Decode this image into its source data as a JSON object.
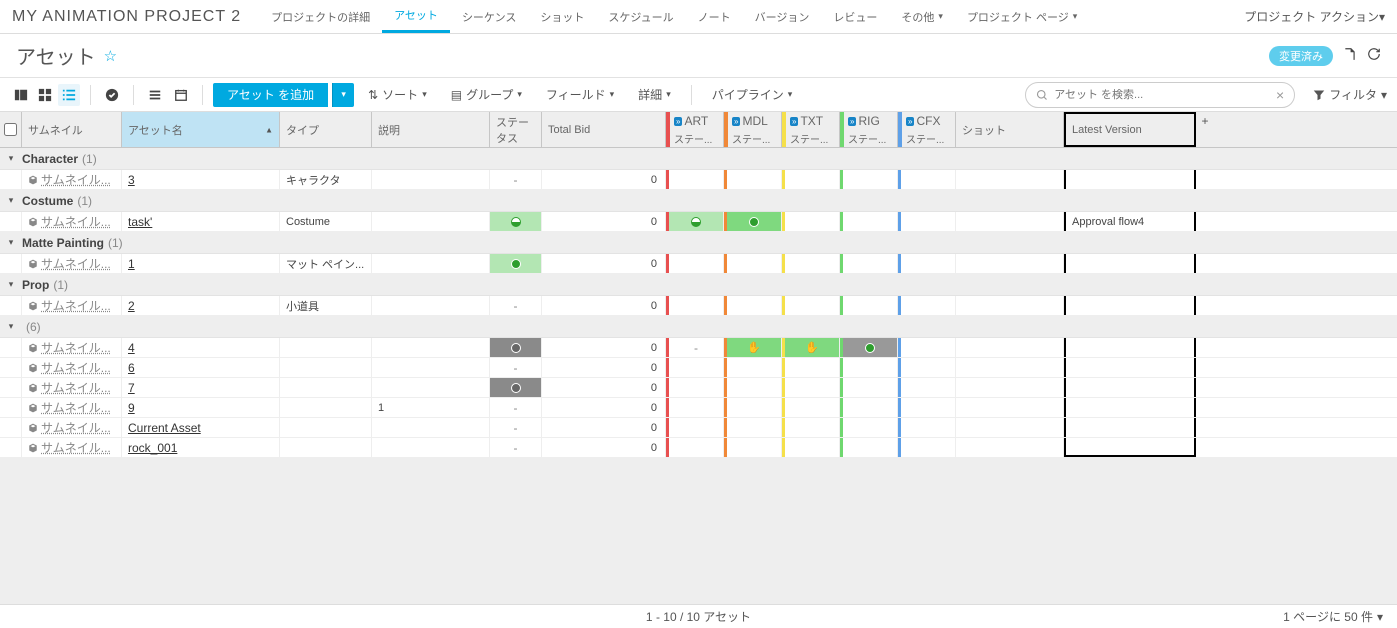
{
  "topbar": {
    "project": "MY ANIMATION PROJECT 2",
    "tabs": [
      "プロジェクトの詳細",
      "アセット",
      "シーケンス",
      "ショット",
      "スケジュール",
      "ノート",
      "バージョン",
      "レビュー",
      "その他",
      "プロジェクト ページ"
    ],
    "active_tab": 1,
    "dropdown_tabs": [
      8,
      9
    ],
    "actions": "プロジェクト アクション"
  },
  "page": {
    "title": "アセット",
    "badge": "変更済み"
  },
  "toolbar": {
    "add": "アセット を追加",
    "sort": "ソート",
    "group": "グループ",
    "fields": "フィールド",
    "detail": "詳細",
    "pipeline": "パイプライン",
    "search_placeholder": "アセット を検索...",
    "filter": "フィルタ"
  },
  "columns": {
    "thumb": "サムネイル",
    "name": "アセット名",
    "type": "タイプ",
    "desc": "説明",
    "status": "ステータス",
    "bid": "Total Bid",
    "shot": "ショット",
    "latest": "Latest Version",
    "pipe_sub": "ステー...",
    "pipes": [
      {
        "code": "ART",
        "color": "#e85050"
      },
      {
        "code": "MDL",
        "color": "#f08838"
      },
      {
        "code": "TXT",
        "color": "#f5e04a"
      },
      {
        "code": "RIG",
        "color": "#6fd86f"
      },
      {
        "code": "CFX",
        "color": "#5ea0e8"
      }
    ]
  },
  "groups": [
    {
      "name": "Character",
      "count": 1,
      "rows": [
        {
          "name": "3",
          "type": "キャラクタ",
          "status": "dash",
          "bid": "0",
          "pipes": [
            "",
            "",
            "",
            "",
            ""
          ],
          "latest": ""
        }
      ]
    },
    {
      "name": "Costume",
      "count": 1,
      "rows": [
        {
          "name": "task'",
          "type": "Costume",
          "status": "half-green-light",
          "bid": "0",
          "pipes": [
            "half-green-light",
            "dot-green",
            null,
            null,
            null
          ],
          "latest": "Approval flow4"
        }
      ]
    },
    {
      "name": "Matte Painting",
      "count": 1,
      "rows": [
        {
          "name": "1",
          "type": "マット ペイン...",
          "status": "dot-green-light",
          "bid": "0",
          "pipes": [
            "",
            "",
            "",
            "",
            ""
          ],
          "latest": ""
        }
      ]
    },
    {
      "name": "Prop",
      "count": 1,
      "rows": [
        {
          "name": "2",
          "type": "小道具",
          "status": "dash",
          "bid": "0",
          "pipes": [
            "",
            "",
            "",
            "",
            ""
          ],
          "latest": ""
        }
      ]
    },
    {
      "name": "",
      "count": 6,
      "rows": [
        {
          "name": "4",
          "type": "",
          "status": "grey-dot",
          "bid": "0",
          "pipes": [
            "dash",
            "hand-green",
            "hand-green",
            "dot-grey-bg",
            ""
          ],
          "latest": ""
        },
        {
          "name": "6",
          "type": "",
          "status": "dash",
          "bid": "0",
          "pipes": [
            "",
            "",
            "",
            "",
            ""
          ],
          "latest": ""
        },
        {
          "name": "7",
          "type": "",
          "status": "grey-dot",
          "bid": "0",
          "pipes": [
            "",
            "",
            "",
            "",
            ""
          ],
          "latest": ""
        },
        {
          "name": "9",
          "type": "",
          "desc": "1",
          "status": "dash",
          "bid": "0",
          "pipes": [
            "",
            "",
            "",
            "",
            ""
          ],
          "latest": ""
        },
        {
          "name": "Current Asset",
          "type": "",
          "status": "dash",
          "bid": "0",
          "pipes": [
            "",
            "",
            "",
            "",
            ""
          ],
          "latest": ""
        },
        {
          "name": "rock_001",
          "type": "",
          "status": "dash",
          "bid": "0",
          "pipes": [
            "",
            "",
            "",
            "",
            ""
          ],
          "latest": ""
        }
      ]
    }
  ],
  "thumb_label": "サムネイル...",
  "footer": {
    "range": "1 - 10 / 10 アセット",
    "perpage": "1 ページに 50 件"
  }
}
